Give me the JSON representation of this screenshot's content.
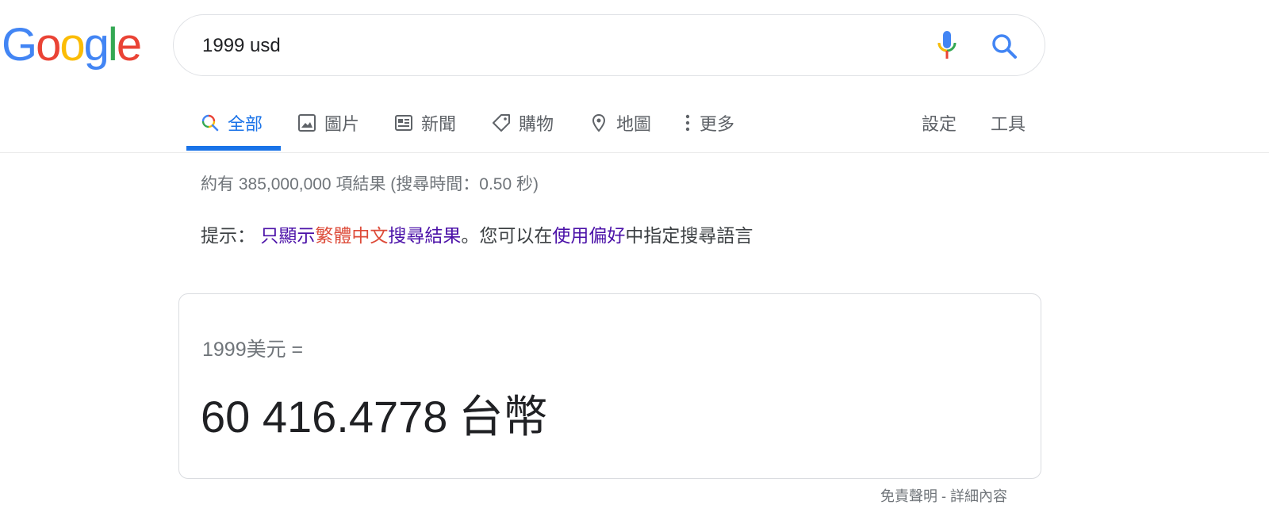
{
  "logo": {
    "letters": [
      "G",
      "o",
      "o",
      "g",
      "l",
      "e"
    ],
    "colors": [
      "#4285F4",
      "#EA4335",
      "#FBBC05",
      "#4285F4",
      "#34A853",
      "#EA4335"
    ]
  },
  "search": {
    "query": "1999 usd",
    "mic_icon": "microphone-icon",
    "search_icon": "search-icon"
  },
  "tabs": [
    {
      "label": "全部",
      "icon": "search-icon",
      "active": true
    },
    {
      "label": "圖片",
      "icon": "image-icon",
      "active": false
    },
    {
      "label": "新聞",
      "icon": "news-icon",
      "active": false
    },
    {
      "label": "購物",
      "icon": "tag-icon",
      "active": false
    },
    {
      "label": "地圖",
      "icon": "map-pin-icon",
      "active": false
    },
    {
      "label": "更多",
      "icon": "more-vertical-icon",
      "active": false
    }
  ],
  "tools": {
    "settings": "設定",
    "tools": "工具"
  },
  "stats": "約有 385,000,000 項結果 (搜尋時間：0.50 秒)",
  "tip": {
    "prefix": "提示：",
    "link1_part1": "只顯示",
    "link1_part2": "繁體中文",
    "link1_part3": "搜尋結果",
    "middle": "。您可以在",
    "link2": "使用偏好",
    "suffix": "中指定搜尋語言"
  },
  "converter": {
    "from": "1999美元 =",
    "to_value": "60 416.4778",
    "to_unit": "台幣"
  },
  "disclaimer": "免責聲明 - 詳細內容",
  "colors": {
    "accent": "#1a73e8",
    "link": "#1a0dab",
    "visited": "#4b11a8",
    "highlight": "#dd4b39"
  }
}
